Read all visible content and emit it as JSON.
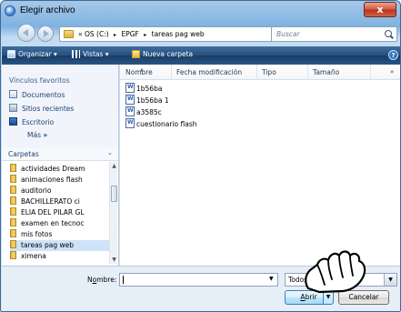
{
  "window": {
    "title": "Elegir archivo",
    "close_label": "x"
  },
  "address": {
    "segments": [
      "« OS (C:)",
      "EPGF",
      "tareas pag web"
    ],
    "separator": "▸",
    "search_placeholder": "Buscar"
  },
  "toolbar": {
    "organize_label": "Organizar ▾",
    "views_label": "Vistas ▾",
    "new_folder_label": "Nueva carpeta",
    "help_label": "?"
  },
  "favorites": {
    "header": "Vínculos favoritos",
    "items": [
      {
        "label": "Documentos",
        "icon": "documents-icon"
      },
      {
        "label": "Sitios recientes",
        "icon": "recent-places-icon"
      },
      {
        "label": "Escritorio",
        "icon": "desktop-icon"
      }
    ],
    "more_label": "Más",
    "more_suffix": "»"
  },
  "folders": {
    "header": "Carpetas",
    "items": [
      "actividades Dream",
      "animaciones flash",
      "auditorio",
      "BACHILLERATO ci",
      "ELIA DEL PILAR GL",
      "examen en tecnoc",
      "mis fotos",
      "tareas pag web",
      "ximena"
    ],
    "selected": "tareas pag web"
  },
  "file_list": {
    "columns": [
      "Nombre",
      "Fecha modificación",
      "Tipo",
      "Tamaño"
    ],
    "more": "»",
    "files": [
      "1b56ba",
      "1b56ba 1",
      "a3585c",
      "cuestionario flash"
    ]
  },
  "bottom": {
    "name_label_prefix": "N",
    "name_label_underlined": "o",
    "name_label_suffix": "mbre:",
    "name_value": "",
    "type_value": "Todos",
    "open_underlined": "A",
    "open_rest": "brir",
    "cancel_label": "Cancelar"
  }
}
